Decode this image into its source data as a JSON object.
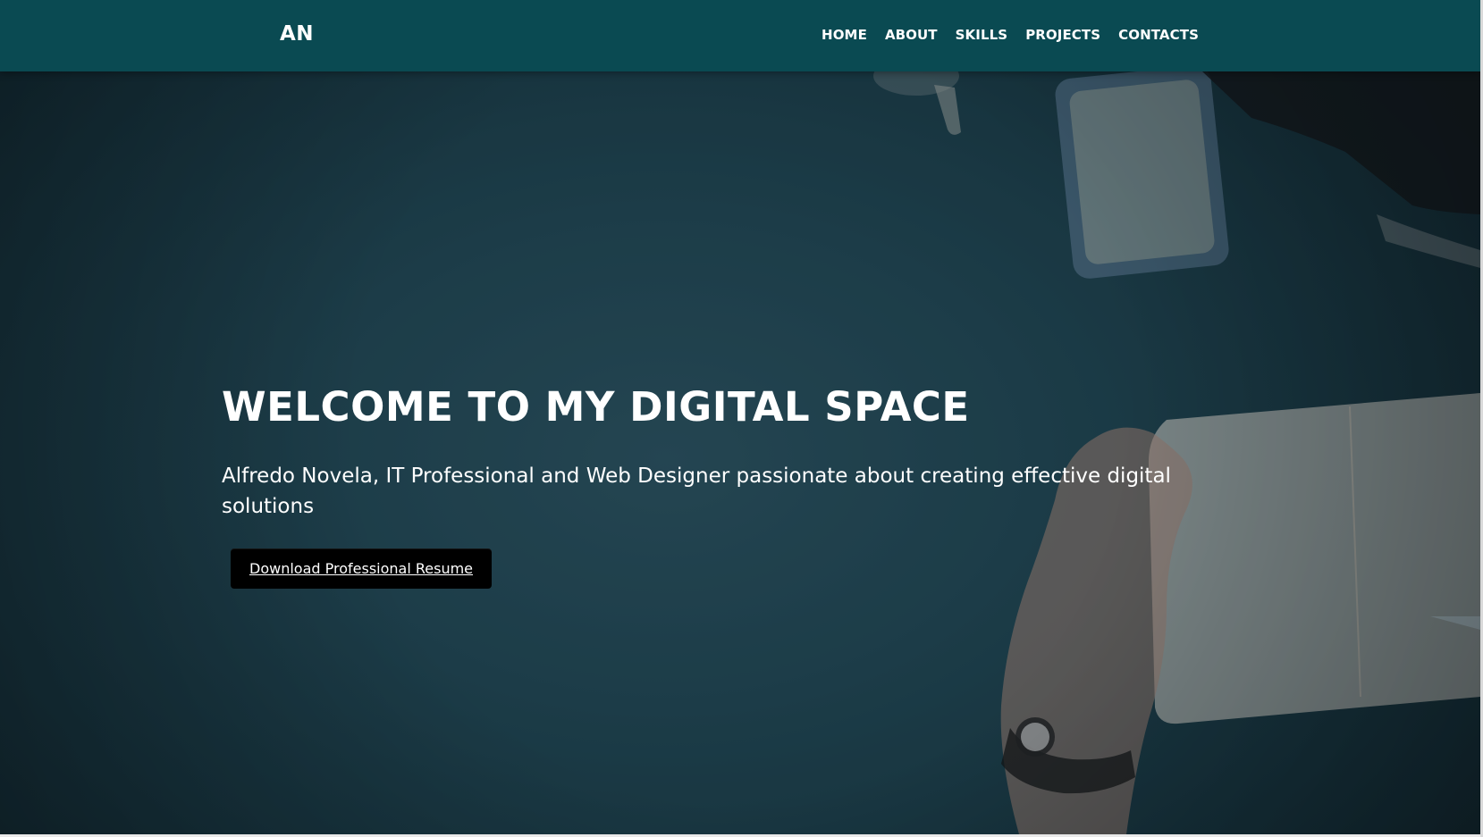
{
  "navbar": {
    "logo": "AN",
    "links": [
      "HOME",
      "ABOUT",
      "SKILLS",
      "PROJECTS",
      "CONTACTS"
    ]
  },
  "hero": {
    "title": "WELCOME TO MY DIGITAL SPACE",
    "subtitle": "Alfredo Novela, IT Professional and Web Designer passionate about creating effective digital solutions",
    "button_label": "Download Professional Resume"
  },
  "colors": {
    "navbar": "#0a4a52",
    "hero_overlay": "#1f4653",
    "button": "#000000",
    "text": "#ffffff"
  }
}
